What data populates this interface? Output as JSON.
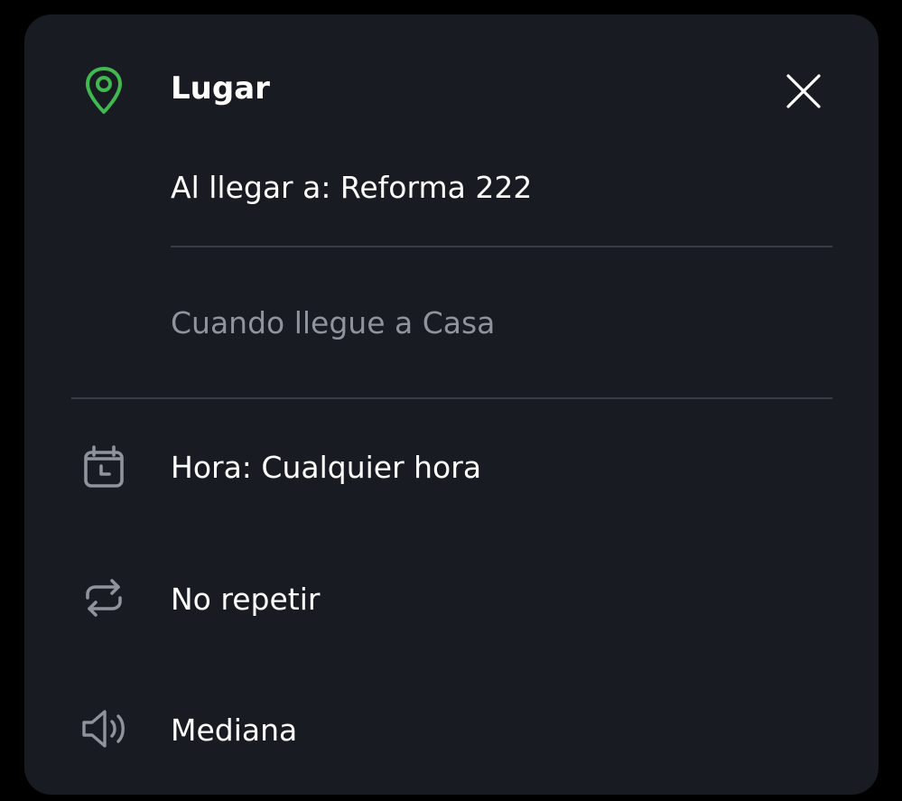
{
  "dialog": {
    "title": "Lugar",
    "location_value": "Al llegar a: Reforma 222",
    "alternative_option": "Cuando llegue a Casa",
    "time_row": "Hora: Cualquier hora",
    "repeat_row": "No repetir",
    "volume_row": "Mediana"
  },
  "icons": {
    "location": "location-pin-icon",
    "close": "close-icon",
    "time": "calendar-clock-icon",
    "repeat": "repeat-icon",
    "volume": "speaker-icon"
  },
  "colors": {
    "background": "#000000",
    "card": "#181b21",
    "accent_green": "#3fb950",
    "text_primary": "#ffffff",
    "text_secondary": "#8e939c",
    "icon_gray": "#8e939c",
    "divider": "#373b43"
  }
}
